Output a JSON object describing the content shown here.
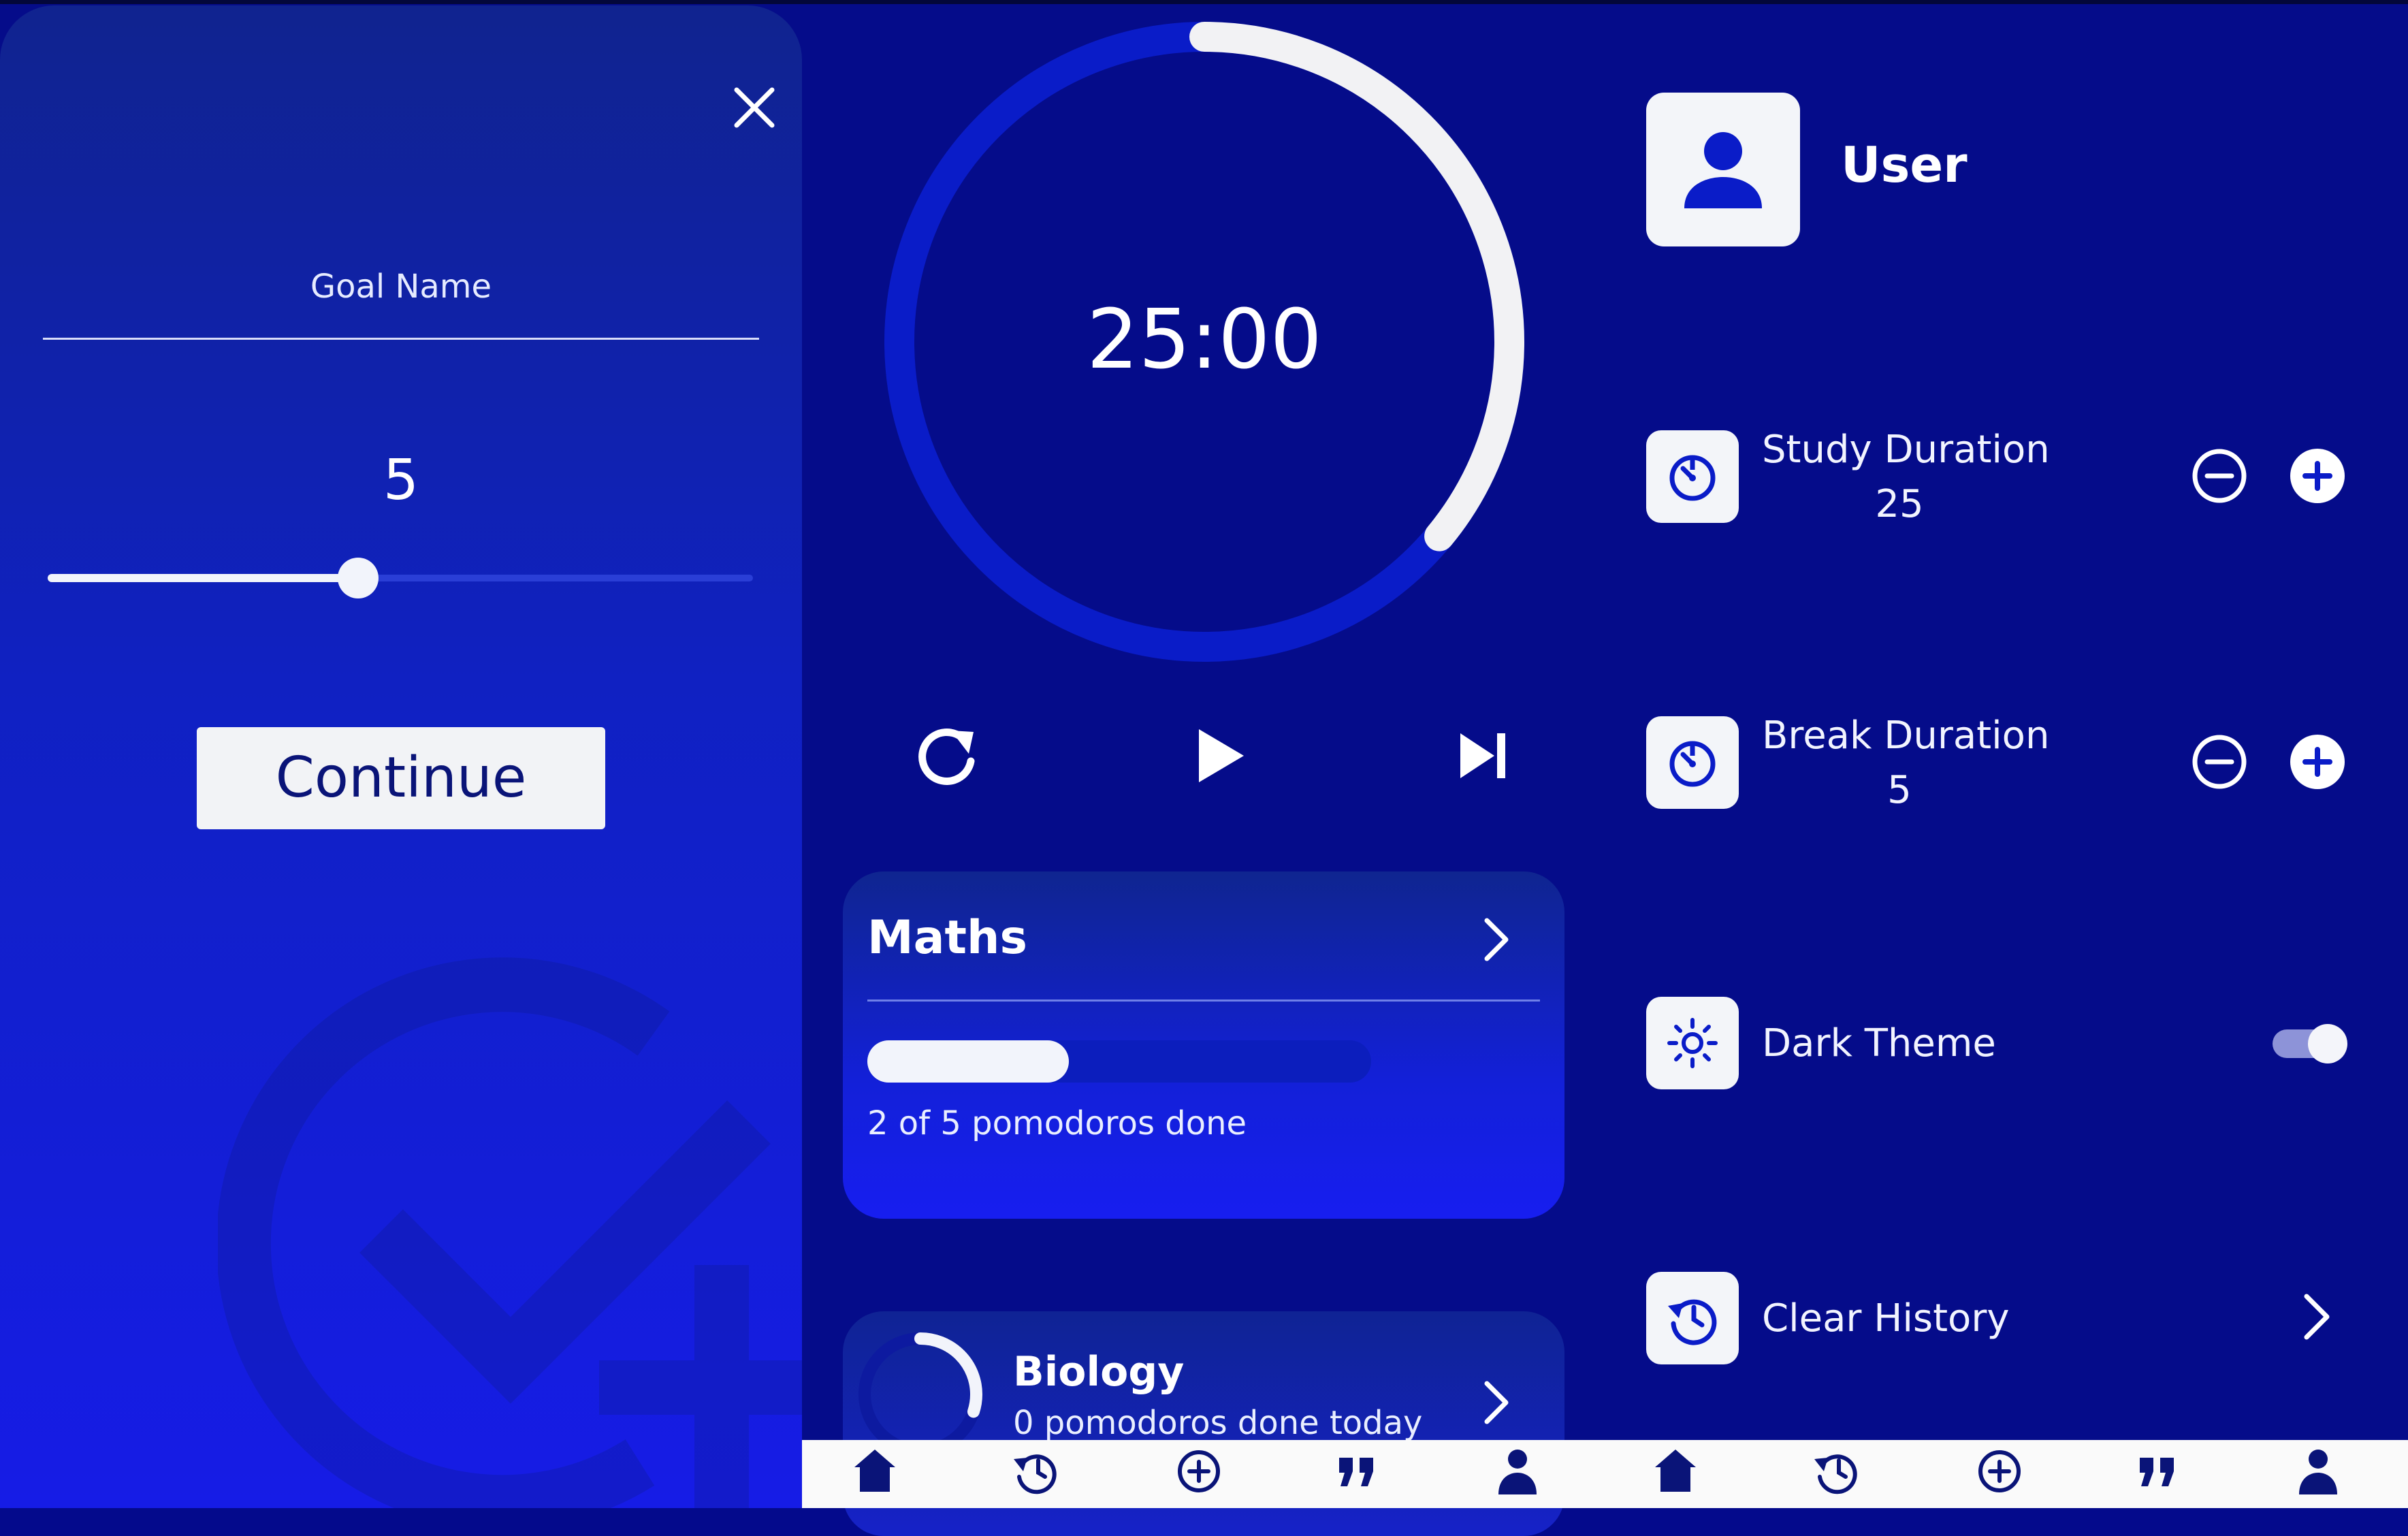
{
  "colors": {
    "background": "#040a8c",
    "panel_gradient_top": "#10238f",
    "panel_gradient_bottom": "#161ce6",
    "accent_white": "#f2f4fb",
    "icon_blue": "#0a1cc8",
    "nav_bar": "#fafafa"
  },
  "goal_form": {
    "close_icon": "close-icon",
    "name_placeholder": "Goal Name",
    "pomodoros_value": "5",
    "slider_fraction": 0.44,
    "continue_label": "Continue",
    "watermark_icon": "check-add-icon"
  },
  "timer": {
    "time": "25:00",
    "progress_fraction": 0.36,
    "controls": [
      "restart-icon",
      "play-icon",
      "skip-next-icon"
    ]
  },
  "goals": [
    {
      "title": "Maths",
      "subtitle": "2 of 5 pomodoros done",
      "done": 2,
      "total": 5
    },
    {
      "title": "Biology",
      "subtitle": "0 pomodoros done today",
      "ring_fraction": 0.3
    }
  ],
  "settings": {
    "user": {
      "name": "User",
      "icon": "person-icon"
    },
    "study_duration": {
      "label": "Study Duration",
      "value": "25",
      "icon": "timer-icon"
    },
    "break_duration": {
      "label": "Break Duration",
      "value": "5",
      "icon": "timer-icon"
    },
    "dark_theme": {
      "label": "Dark Theme",
      "enabled": true,
      "icon": "sun-icon"
    },
    "clear_history": {
      "label": "Clear History",
      "icon": "history-icon"
    }
  },
  "bottom_nav": {
    "items": [
      "home-icon",
      "history-icon",
      "add-circle-icon",
      "quote-icon",
      "person-icon",
      "home-icon",
      "history-icon",
      "add-circle-icon",
      "quote-icon",
      "person-icon"
    ]
  }
}
